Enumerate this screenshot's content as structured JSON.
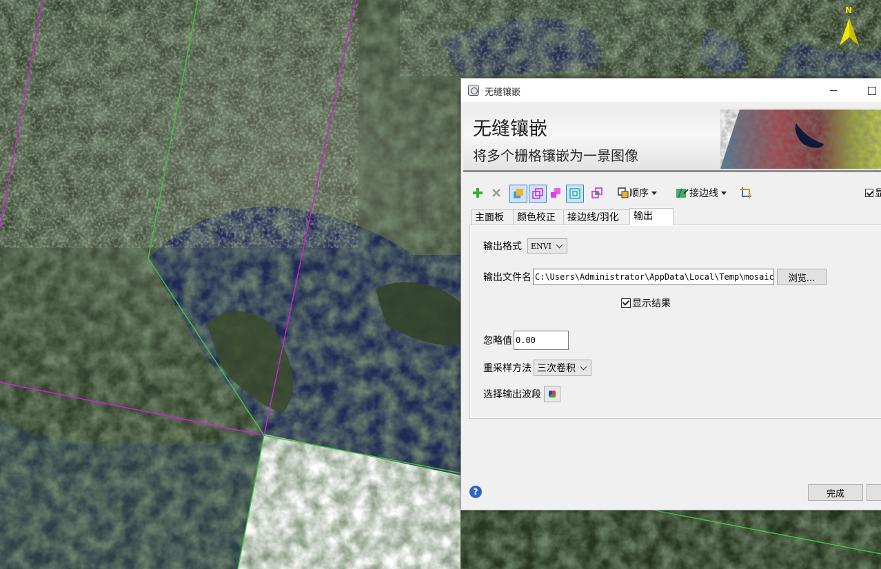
{
  "map": {
    "north_label": "N"
  },
  "dialog": {
    "window_title": "无缝镶嵌",
    "banner": {
      "title": "无缝镶嵌",
      "subtitle": "将多个栅格镶嵌为一景图像"
    },
    "toolbar": {
      "icons": [
        "add-icon",
        "remove-icon",
        "auto-color-icon",
        "footprint-icon",
        "seamline-icon",
        "view-icon",
        "overview-icon"
      ],
      "order_label": "顺序",
      "seamline_label": "接边线",
      "show_checkbox": {
        "checked": true,
        "label": "显"
      }
    },
    "tabs": [
      "主面板",
      "颜色校正",
      "接边线/羽化",
      "输出"
    ],
    "active_tab": "输出",
    "output": {
      "format_label": "输出格式",
      "format_value": "ENVI",
      "filename_label": "输出文件名",
      "filename_value": "C:\\Users\\Administrator\\AppData\\Local\\Temp\\mosaic",
      "browse_label": "浏览...",
      "display_result_label": "显示结果",
      "display_result_checked": true,
      "ignore_label": "忽略值",
      "ignore_value": "0.00",
      "resample_label": "重采样方法",
      "resample_value": "三次卷积",
      "bands_label": "选择输出波段"
    },
    "footer": {
      "help_symbol": "?",
      "finish_label": "完成"
    }
  },
  "colors": {
    "seam_green": "#3cc43c",
    "footprint_magenta": "#d020d8",
    "help_blue": "#2f64c8"
  }
}
